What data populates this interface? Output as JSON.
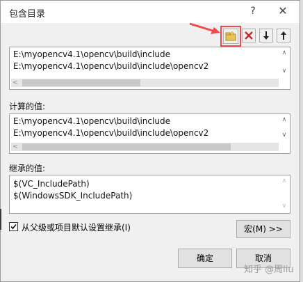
{
  "dialog": {
    "title": "包含目录",
    "help_label": "?",
    "close_label": "✕"
  },
  "toolbar": {
    "new_folder_icon": "new-folder-icon",
    "delete_icon": "delete-x-icon",
    "move_down_icon": "arrow-down-icon",
    "move_up_icon": "arrow-up-icon",
    "highlight_color": "#f04b4b"
  },
  "include_list": {
    "items": [
      "E:\\myopencv4.1\\opencv\\build\\include",
      "E:\\myopencv4.1\\opencv\\build\\include\\opencv2"
    ]
  },
  "computed": {
    "label": "计算的值:",
    "items": [
      "E:\\myopencv4.1\\opencv\\build\\include",
      "E:\\myopencv4.1\\opencv\\build\\include\\opencv2"
    ]
  },
  "inherited": {
    "label": "继承的值:",
    "items": [
      "$(VC_IncludePath)",
      "$(WindowsSDK_IncludePath)"
    ]
  },
  "inherit_checkbox": {
    "label": "从父级或项目默认设置继承(I)",
    "checked": true
  },
  "buttons": {
    "macro": "宏(M) >>",
    "ok": "确定",
    "cancel": "取消"
  },
  "watermark": "知乎 @周liu"
}
